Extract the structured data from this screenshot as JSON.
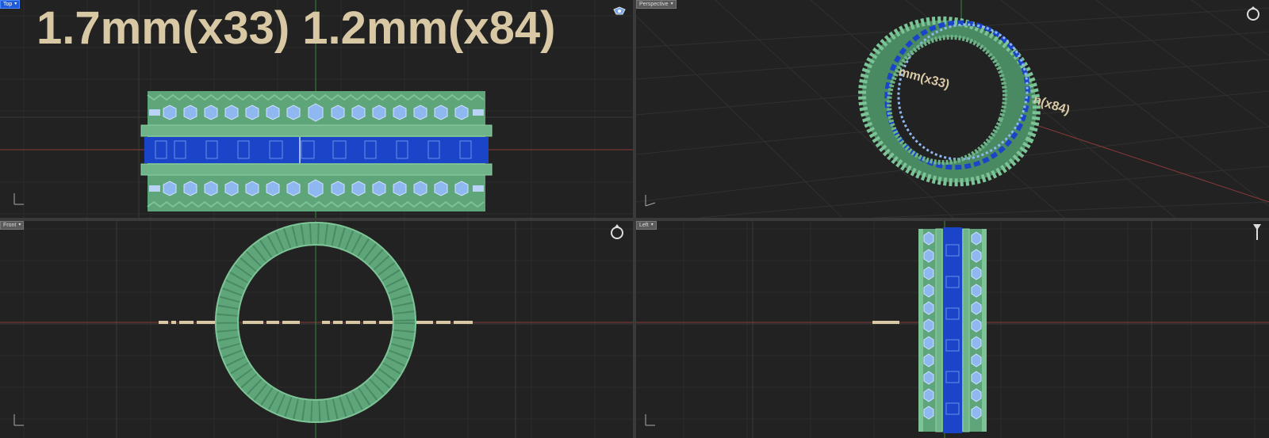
{
  "viewports": {
    "top": {
      "tab_label": "Top",
      "label_text": "1.7mm(x33) 1.2mm(x84)"
    },
    "perspective": {
      "tab_label": "Perspective",
      "label_text_a": "mm(x33)",
      "label_text_b": "n(x84)"
    },
    "front": {
      "tab_label": "Front"
    },
    "left": {
      "tab_label": "Left"
    }
  },
  "colors": {
    "viewport_bg": "#222222",
    "grid_line": "#2e2e2e",
    "grid_major": "#3b3b3b",
    "axis_x": "#8a3a3a",
    "axis_y": "#3a8a3a",
    "ring_metal": "#5fa57a",
    "ring_metal_dark": "#4a8a63",
    "stone_light": "#8fb8f0",
    "channel_blue": "#1a45c8",
    "text_label": "#d9c8a4",
    "active_tab": "#1e5bd8"
  },
  "icons": {
    "top": "jewelry-icon",
    "perspective": "ring-icon",
    "front": "ring-icon",
    "left": "setting-icon"
  }
}
